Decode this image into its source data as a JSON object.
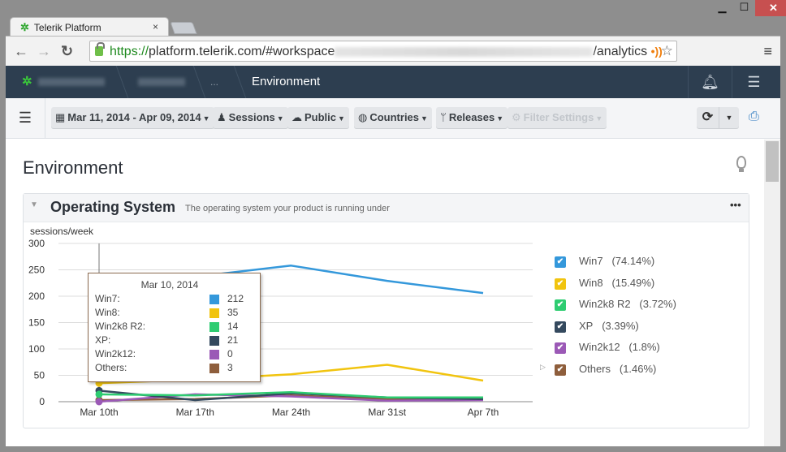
{
  "browser": {
    "tab_title": "Telerik Platform",
    "tab_close": "×",
    "url_scheme": "https://",
    "url_host": "platform.telerik.com/#workspace",
    "url_tail": "/analytics",
    "window_controls": {
      "minimize": "▁",
      "maximize": "☐",
      "close": "✕"
    }
  },
  "appbar": {
    "breadcrumb": [
      {
        "label": "(blurred)",
        "blurred": true
      },
      {
        "label": "(blurred)",
        "blurred": true
      },
      {
        "label": "...",
        "blurred": false
      },
      {
        "label": "Environment",
        "blurred": false
      }
    ]
  },
  "filters": {
    "date_range": "Mar 11, 2014 - Apr 09, 2014",
    "sessions": "Sessions",
    "public": "Public",
    "countries": "Countries",
    "releases": "Releases",
    "filter_settings": "Filter Settings"
  },
  "page": {
    "title": "Environment"
  },
  "panel": {
    "title": "Operating System",
    "subtitle": "The operating system your product is running under",
    "more": "•••"
  },
  "tooltip": {
    "date": "Mar 10, 2014",
    "rows": [
      {
        "name": "Win7:",
        "value": "212",
        "color": "#3498db"
      },
      {
        "name": "Win8:",
        "value": "35",
        "color": "#f1c40f"
      },
      {
        "name": "Win2k8 R2:",
        "value": "14",
        "color": "#2ecc71"
      },
      {
        "name": "XP:",
        "value": "21",
        "color": "#34495e"
      },
      {
        "name": "Win2k12:",
        "value": "0",
        "color": "#9b59b6"
      },
      {
        "name": "Others:",
        "value": "3",
        "color": "#8e5e3c"
      }
    ]
  },
  "legend": [
    {
      "label": "Win7",
      "pct": "(74.14%)",
      "color": "#3498db",
      "checked": true
    },
    {
      "label": "Win8",
      "pct": "(15.49%)",
      "color": "#f1c40f",
      "checked": true
    },
    {
      "label": "Win2k8 R2",
      "pct": "(3.72%)",
      "color": "#2ecc71",
      "checked": true
    },
    {
      "label": "XP",
      "pct": "(3.39%)",
      "color": "#34495e",
      "checked": true
    },
    {
      "label": "Win2k12",
      "pct": "(1.8%)",
      "color": "#9b59b6",
      "checked": true
    },
    {
      "label": "Others",
      "pct": "(1.46%)",
      "color": "#8e5e3c",
      "checked": true
    }
  ],
  "chart_data": {
    "type": "line",
    "title": "Operating System",
    "xlabel": "",
    "ylabel": "sessions/week",
    "categories": [
      "Mar 10th",
      "Mar 17th",
      "Mar 24th",
      "Mar 31st",
      "Apr 7th"
    ],
    "ylim": [
      0,
      300
    ],
    "yticks": [
      0,
      50,
      100,
      150,
      200,
      250,
      300
    ],
    "grid": true,
    "legend_position": "right",
    "series": [
      {
        "name": "Win7",
        "color": "#3498db",
        "values": [
          212,
          237,
          258,
          229,
          206
        ]
      },
      {
        "name": "Win8",
        "color": "#f1c40f",
        "values": [
          35,
          42,
          52,
          70,
          40
        ]
      },
      {
        "name": "Win2k8 R2",
        "color": "#2ecc71",
        "values": [
          14,
          12,
          18,
          8,
          8
        ]
      },
      {
        "name": "XP",
        "color": "#34495e",
        "values": [
          21,
          3,
          16,
          8,
          5
        ]
      },
      {
        "name": "Win2k12",
        "color": "#9b59b6",
        "values": [
          0,
          14,
          10,
          2,
          3
        ]
      },
      {
        "name": "Others",
        "color": "#8e5e3c",
        "values": [
          3,
          5,
          12,
          5,
          4
        ]
      }
    ],
    "highlighted_category": "Mar 10th"
  }
}
